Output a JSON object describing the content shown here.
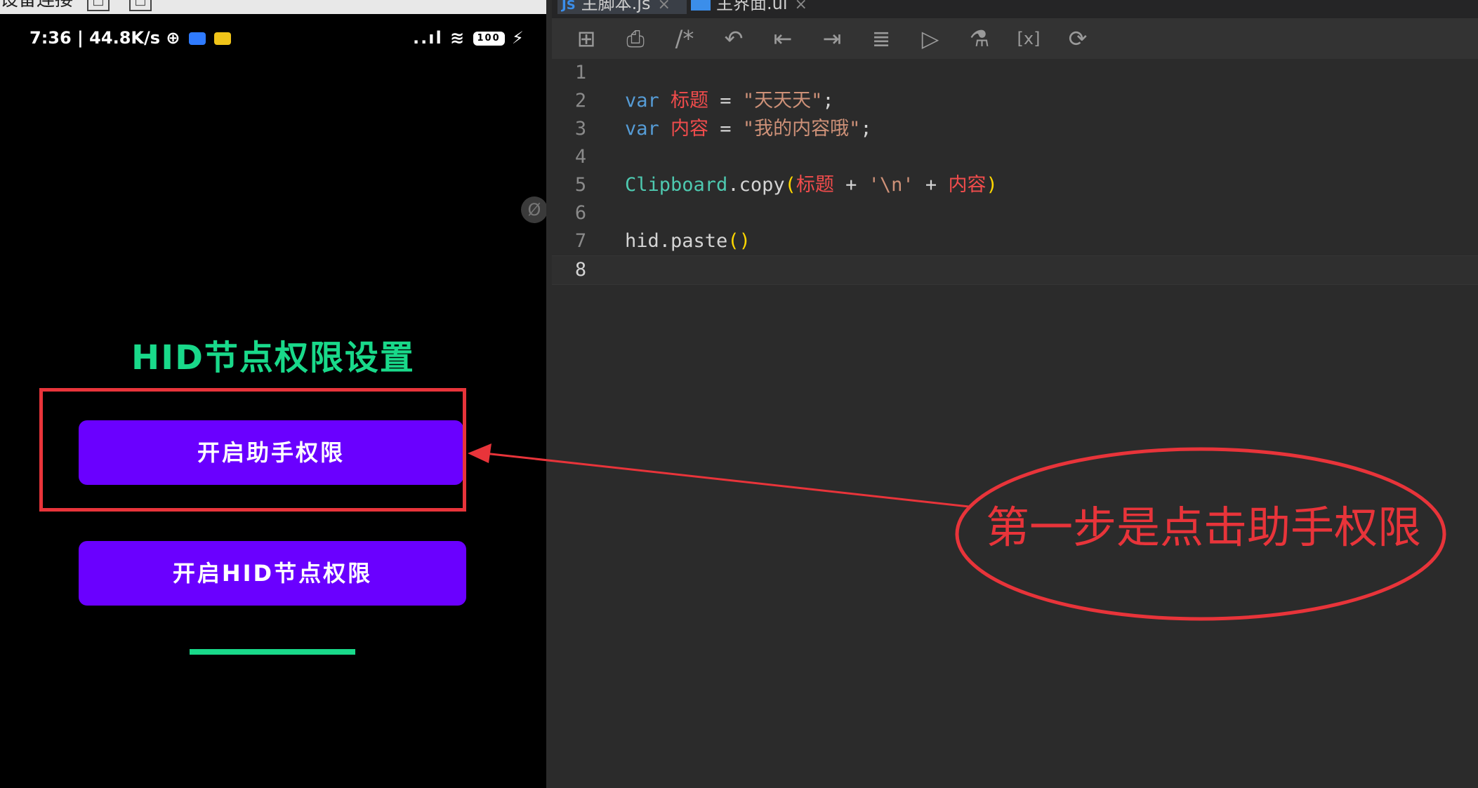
{
  "device_window": {
    "title": "设备连接",
    "buttons": [
      "□",
      "□"
    ]
  },
  "phone": {
    "status_left": "7:36 | 44.8K/s ⊕",
    "status_signal": "..ıl ≋",
    "battery": "100",
    "floating_icon": "Ø",
    "app_title": "HID节点权限设置",
    "buttons": {
      "assist": "开启助手权限",
      "hid": "开启HID节点权限"
    },
    "progress": 1.0
  },
  "editor": {
    "tabs": [
      {
        "label": "主脚本.js",
        "icon": "JS",
        "active": true
      },
      {
        "label": "主界面.ui",
        "icon": "ui-layout-icon",
        "active": false
      }
    ],
    "toolbar": [
      {
        "name": "new-file-icon",
        "glyph": "⊞"
      },
      {
        "name": "print-icon",
        "glyph": "⎙"
      },
      {
        "name": "comment-icon",
        "glyph": "/*"
      },
      {
        "name": "undo-icon",
        "glyph": "↶"
      },
      {
        "name": "outdent-icon",
        "glyph": "⇤"
      },
      {
        "name": "indent-icon",
        "glyph": "⇥"
      },
      {
        "name": "format-icon",
        "glyph": "≣"
      },
      {
        "name": "run-icon",
        "glyph": "▷"
      },
      {
        "name": "test-flask-icon",
        "glyph": "⚗"
      },
      {
        "name": "variable-icon",
        "glyph": "[x]"
      },
      {
        "name": "clear-icon",
        "glyph": "⟳"
      }
    ],
    "line_numbers": [
      "1",
      "2",
      "3",
      "4",
      "5",
      "6",
      "7",
      "8"
    ],
    "code": {
      "l2_kw": "var",
      "l2_var": "标题",
      "l2_eq": " = ",
      "l2_str": "\"天天天\"",
      "l2_end": ";",
      "l3_kw": "var",
      "l3_var": "内容",
      "l3_eq": " = ",
      "l3_str": "\"我的内容哦\"",
      "l3_end": ";",
      "l5_cls": "Clipboard",
      "l5_method": ".copy",
      "l5_po": "(",
      "l5_v1": "标题",
      "l5_plus1": " + ",
      "l5_str": "'\\n'",
      "l5_plus2": " + ",
      "l5_v2": "内容",
      "l5_pc": ")",
      "l7_fn": "hid.paste",
      "l7_parens": "()"
    }
  },
  "annotation": {
    "text": "第一步是点击助手权限",
    "color": "#e8343a"
  },
  "colors": {
    "accent_green": "#19d98a",
    "button_purple": "#6a00ff",
    "annotation_red": "#e8343a"
  }
}
